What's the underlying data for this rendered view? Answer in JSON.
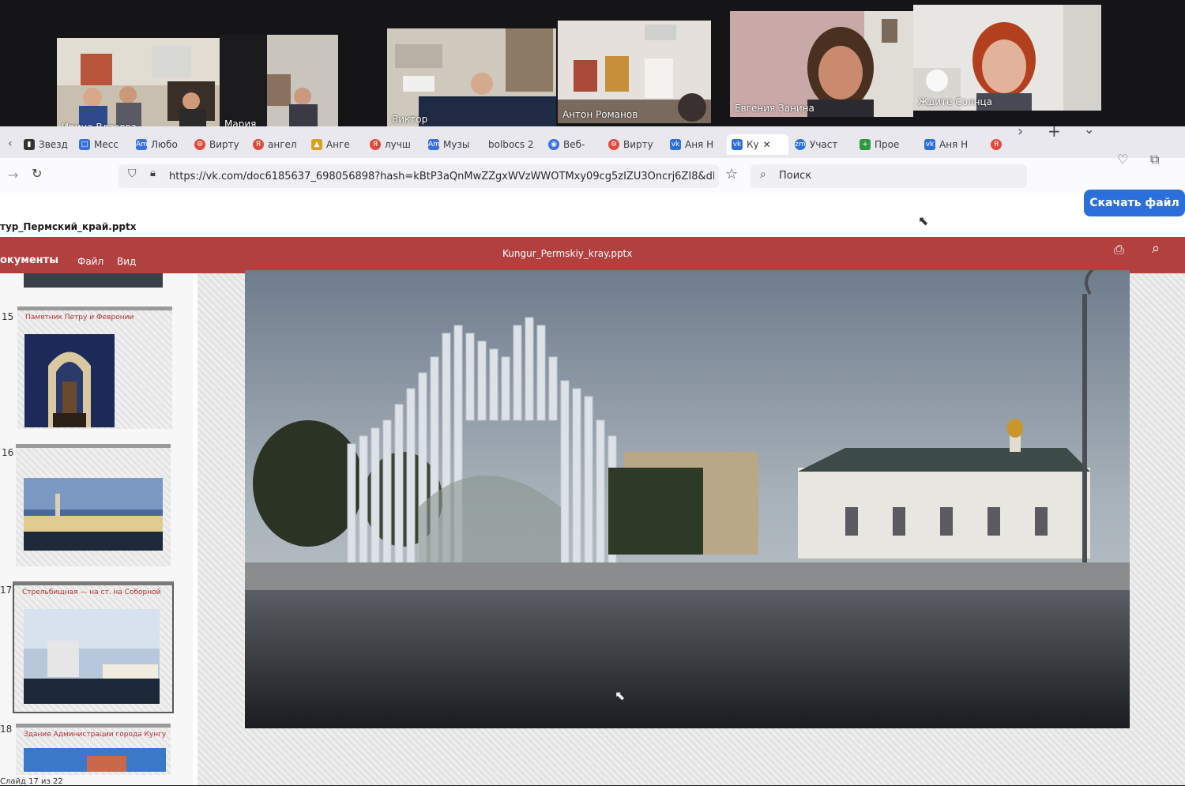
{
  "video_call": {
    "participants": [
      {
        "name": "Ирина Власова",
        "active": false
      },
      {
        "name": "Мария",
        "active": false
      },
      {
        "name": "Виктор",
        "active": false
      },
      {
        "name": "Антон Романов",
        "active": false
      },
      {
        "name": "Евгения Занина",
        "active": true
      },
      {
        "name": "Ждите Солнца",
        "active": false
      }
    ],
    "active_color": "#3fd45a"
  },
  "browser": {
    "tabs": [
      {
        "label": "Звезд",
        "icon": "bookmark-icon",
        "color": "#444"
      },
      {
        "label": "Месс",
        "icon": "messenger-icon",
        "color": "#3a6fe0"
      },
      {
        "label": "Любо",
        "icon": "am-icon",
        "color": "#3a6fe0"
      },
      {
        "label": "Вирту",
        "icon": "virtual-icon",
        "color": "#e04a3a"
      },
      {
        "label": "ангел",
        "icon": "yandex-icon",
        "color": "#e04a3a"
      },
      {
        "label": "Анге",
        "icon": "image-icon",
        "color": "#d8a020"
      },
      {
        "label": "лучш",
        "icon": "yandex-icon",
        "color": "#e04a3a"
      },
      {
        "label": "Музы",
        "icon": "am-icon",
        "color": "#3a6fe0"
      },
      {
        "label": "bolbocs 2",
        "icon": "",
        "color": ""
      },
      {
        "label": "Веб-",
        "icon": "globe-icon",
        "color": "#3a6fe0"
      },
      {
        "label": "Вирту",
        "icon": "virtual-icon",
        "color": "#e04a3a"
      },
      {
        "label": "Аня Н",
        "icon": "vk-icon",
        "color": "#2a6fdb"
      },
      {
        "label": "Ку",
        "icon": "vk-icon",
        "color": "#2a6fdb",
        "active": true
      },
      {
        "label": "Участ",
        "icon": "zoom-icon",
        "color": "#2a6fdb"
      },
      {
        "label": "Прое",
        "icon": "plus-doc-icon",
        "color": "#2a9a3a"
      },
      {
        "label": "Аня Н",
        "icon": "vk-icon",
        "color": "#2a6fdb"
      },
      {
        "label": "",
        "icon": "yandex-icon",
        "color": "#e04a3a"
      }
    ],
    "url": "https://vk.com/doc6185637_698056898?hash=kBtP3aQnMwZZgxWVzWWOTMxy09cg5zIZU3Oncrj6ZI8&dl=prWd5",
    "search_placeholder": "Поиск"
  },
  "document": {
    "title": "тур_Пермский_край.pptx",
    "download_label": "Скачать файл",
    "viewer": {
      "section": "окументы",
      "menu_file": "Файл",
      "menu_view": "Вид",
      "filename": "Kungur_Permskiy_kray.pptx"
    },
    "slides": [
      {
        "number": "15",
        "caption": "Памятник Петру и Февронии"
      },
      {
        "number": "16",
        "caption": ""
      },
      {
        "number": "17",
        "caption": "Стрельбищная — на ст. на Соборной",
        "selected": true
      },
      {
        "number": "18",
        "caption": "Здание Администрации города Кунгура"
      }
    ],
    "status": "Слайд 17 из 22"
  }
}
